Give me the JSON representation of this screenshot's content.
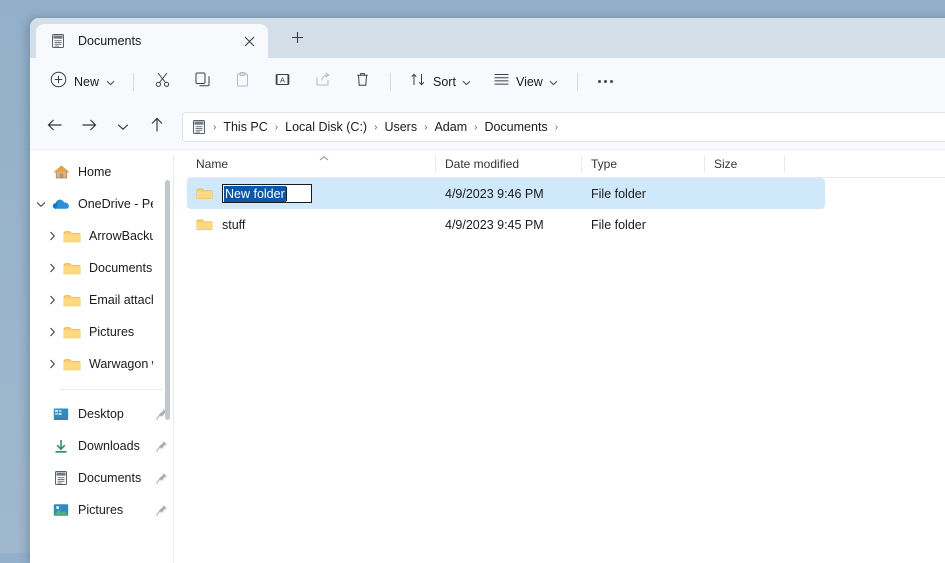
{
  "window": {
    "accent_selection": "#cfe8fa",
    "titlebar_bg": "#d4dfe9",
    "chrome_bg": "#f7f9fc"
  },
  "tabs": [
    {
      "title": "Documents",
      "icon": "documents-tab-icon",
      "close_label": "✕"
    }
  ],
  "newtab": {
    "label": "+",
    "icon": "plus-icon"
  },
  "toolbar": {
    "new_label": "New",
    "new_icon": "plus-circle-icon",
    "chevron": "⌄",
    "buttons": [
      {
        "name": "cut-button",
        "icon": "scissors-icon"
      },
      {
        "name": "copy-button",
        "icon": "copy-icon"
      },
      {
        "name": "paste-button",
        "icon": "clipboard-icon"
      },
      {
        "name": "rename-button",
        "icon": "rename-icon"
      },
      {
        "name": "share-button",
        "icon": "share-icon"
      },
      {
        "name": "delete-button",
        "icon": "trash-icon"
      }
    ],
    "sort_label": "Sort",
    "sort_icon": "sort-arrows-icon",
    "view_label": "View",
    "view_icon": "list-lines-icon",
    "more_label": "See more",
    "more_icon": "ellipsis-icon"
  },
  "navbar": {
    "back_icon": "arrow-left-icon",
    "forward_icon": "arrow-right-icon",
    "recent_icon": "chevron-down-icon",
    "up_icon": "arrow-up-icon",
    "address_icon": "documents-folder-icon",
    "breadcrumbs": [
      "This PC",
      "Local Disk (C:)",
      "Users",
      "Adam",
      "Documents"
    ],
    "separator": "›",
    "trailing_separator": "›"
  },
  "sidebar": {
    "items": [
      {
        "label": "Home",
        "icon": "home-icon",
        "chevron": null,
        "pinned": false,
        "indent": false
      },
      {
        "label": "OneDrive - Pers",
        "icon": "onedrive-cloud-icon",
        "chevron": "expanded",
        "pinned": false,
        "indent": false
      },
      {
        "label": "ArrowBackup",
        "icon": "folder-icon",
        "chevron": "collapsed",
        "pinned": false,
        "indent": true
      },
      {
        "label": "Documents",
        "icon": "folder-icon",
        "chevron": "collapsed",
        "pinned": false,
        "indent": true
      },
      {
        "label": "Email attachm",
        "icon": "folder-icon",
        "chevron": "collapsed",
        "pinned": false,
        "indent": true
      },
      {
        "label": "Pictures",
        "icon": "folder-icon",
        "chevron": "collapsed",
        "pinned": false,
        "indent": true
      },
      {
        "label": "Warwagon wo",
        "icon": "folder-icon",
        "chevron": "collapsed",
        "pinned": false,
        "indent": true
      }
    ],
    "quick_access": [
      {
        "label": "Desktop",
        "icon": "desktop-icon",
        "pinned": true
      },
      {
        "label": "Downloads",
        "icon": "downloads-icon",
        "pinned": true
      },
      {
        "label": "Documents",
        "icon": "documents-icon",
        "pinned": true
      },
      {
        "label": "Pictures",
        "icon": "pictures-icon",
        "pinned": true
      }
    ]
  },
  "filelist": {
    "columns": [
      {
        "label": "Name",
        "sorted": "asc"
      },
      {
        "label": "Date modified",
        "sorted": null
      },
      {
        "label": "Type",
        "sorted": null
      },
      {
        "label": "Size",
        "sorted": null
      }
    ],
    "rows": [
      {
        "name": "New folder",
        "date_modified": "4/9/2023 9:46 PM",
        "type": "File folder",
        "size": "",
        "selected": true,
        "renaming": true
      },
      {
        "name": "stuff",
        "date_modified": "4/9/2023 9:45 PM",
        "type": "File folder",
        "size": "",
        "selected": false,
        "renaming": false
      }
    ]
  }
}
